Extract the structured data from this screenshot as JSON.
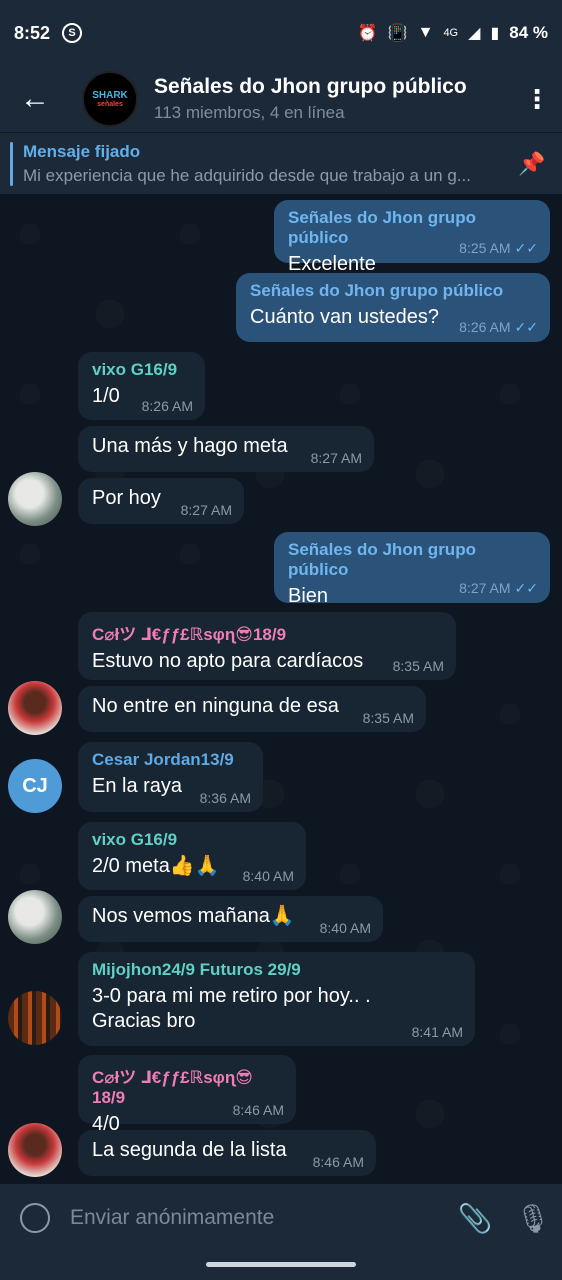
{
  "status": {
    "time": "8:52",
    "network": "4G",
    "battery": "84 %"
  },
  "header": {
    "avatar_text": "SHARK",
    "avatar_sub": "señales",
    "title": "Señales do Jhon grupo público",
    "subtitle": "113 miembros, 4 en línea"
  },
  "pinned": {
    "label": "Mensaje fijado",
    "preview": "Mi experiencia que he adquirido desde que trabajo a un g..."
  },
  "messages": [
    {
      "sender": "Señales do Jhon grupo público",
      "text": "Excelente",
      "time": "8:25 AM"
    },
    {
      "sender": "Señales do Jhon grupo público",
      "text": "Cuánto van ustedes?",
      "time": "8:26 AM"
    },
    {
      "sender": "vixo G16/9",
      "text": "1/0",
      "time": "8:26 AM"
    },
    {
      "text": "Una más y hago meta",
      "time": "8:27 AM"
    },
    {
      "text": "Por hoy",
      "time": "8:27 AM"
    },
    {
      "sender": "Señales do Jhon grupo público",
      "text": "Bien",
      "time": "8:27 AM"
    },
    {
      "sender": "C⌀łツ ⅃€ƒƒ£ℝѕφɳ😎18/9",
      "text": "Estuvo no apto para cardíacos",
      "time": "8:35 AM"
    },
    {
      "text": "No entre en ninguna de esa",
      "time": "8:35 AM"
    },
    {
      "sender": "Cesar Jordan13/9",
      "text": "En la raya",
      "time": "8:36 AM",
      "avatar_initials": "CJ"
    },
    {
      "sender": "vixo G16/9",
      "text": "2/0 meta👍🙏",
      "time": "8:40 AM"
    },
    {
      "text": "Nos vemos mañana🙏",
      "time": "8:40 AM"
    },
    {
      "sender": "Mijojhon24/9 Futuros 29/9",
      "text": "3-0 para mi me retiro por hoy.. . Gracias bro",
      "time": "8:41 AM"
    },
    {
      "sender": "C⌀łツ ⅃€ƒƒ£ℝѕφɳ😎18/9",
      "text": "4/0",
      "time": "8:46 AM"
    },
    {
      "text": "La segunda de la lista",
      "time": "8:46 AM"
    }
  ],
  "colors": {
    "sender_out": "#6fb6f0",
    "sender_vixo": "#5fd0c5",
    "sender_colt": "#ef7eb2",
    "sender_cesar": "#5ea9e6",
    "sender_mijo": "#5fd0c5"
  },
  "input": {
    "placeholder": "Enviar anónimamente"
  }
}
